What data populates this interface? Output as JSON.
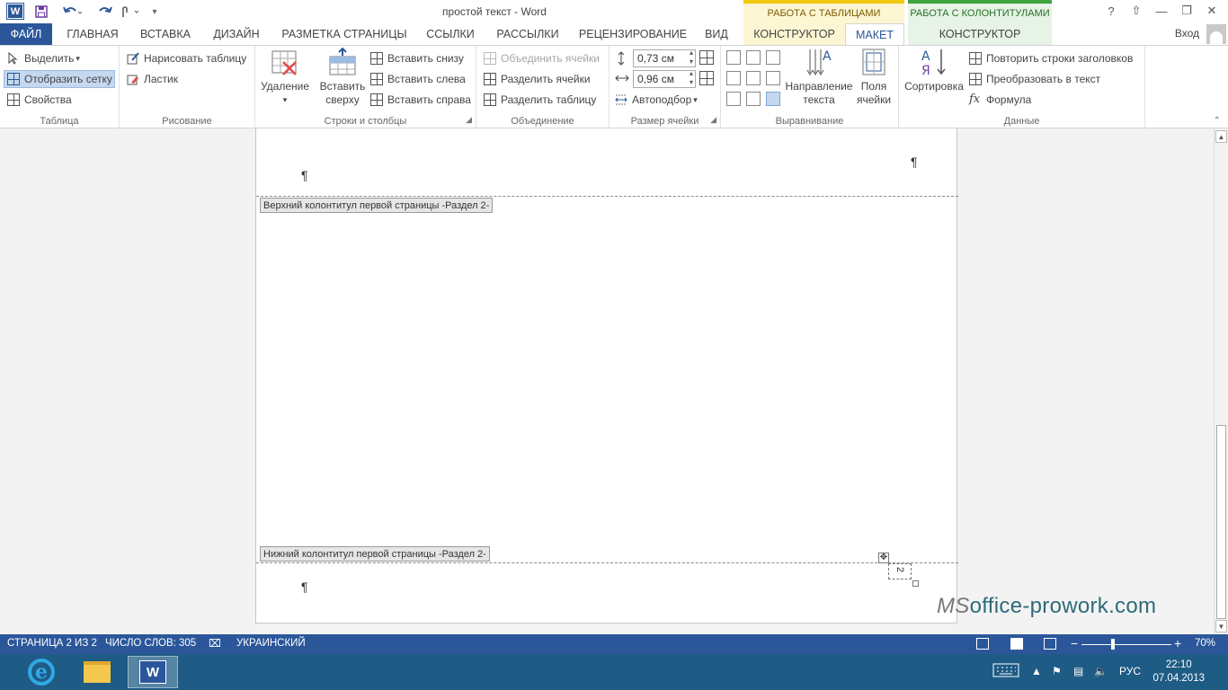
{
  "titlebar": {
    "app_badge": "W",
    "title": "простой текст - Word",
    "context_tables": "РАБОТА С ТАБЛИЦАМИ",
    "context_headers": "РАБОТА С КОЛОНТИТУЛАМИ",
    "help": "?",
    "ribbon_display": "⇧",
    "minimize": "—",
    "restore": "❐",
    "close": "✕"
  },
  "tabs": {
    "file": "ФАЙЛ",
    "home": "ГЛАВНАЯ",
    "insert": "ВСТАВКА",
    "design": "ДИЗАЙН",
    "page_layout": "РАЗМЕТКА СТРАНИЦЫ",
    "references": "ССЫЛКИ",
    "mailings": "РАССЫЛКИ",
    "review": "РЕЦЕНЗИРОВАНИЕ",
    "view": "ВИД",
    "table_design": "КОНСТРУКТОР",
    "table_layout": "МАКЕТ",
    "header_design": "КОНСТРУКТОР",
    "sign_in": "Вход"
  },
  "ribbon": {
    "table": {
      "label": "Таблица",
      "select": "Выделить",
      "view_gridlines": "Отобразить сетку",
      "properties": "Свойства"
    },
    "draw": {
      "label": "Рисование",
      "draw_table": "Нарисовать таблицу",
      "eraser": "Ластик"
    },
    "rows_cols": {
      "label": "Строки и столбцы",
      "delete": "Удаление",
      "insert_above_1": "Вставить",
      "insert_above_2": "сверху",
      "insert_below": "Вставить снизу",
      "insert_left": "Вставить слева",
      "insert_right": "Вставить справа"
    },
    "merge": {
      "label": "Объединение",
      "merge_cells": "Объединить ячейки",
      "split_cells": "Разделить ячейки",
      "split_table": "Разделить таблицу"
    },
    "cell_size": {
      "label": "Размер ячейки",
      "height": "0,73 см",
      "width": "0,96 см",
      "autofit": "Автоподбор"
    },
    "alignment": {
      "label": "Выравнивание",
      "text_direction_1": "Направление",
      "text_direction_2": "текста",
      "cell_margins_1": "Поля",
      "cell_margins_2": "ячейки"
    },
    "data": {
      "label": "Данные",
      "sort": "Сортировка",
      "repeat_headers": "Повторить строки заголовков",
      "convert_text": "Преобразовать в текст",
      "formula": "Формула"
    }
  },
  "document": {
    "pilcrow": "¶",
    "header_tag": "Верхний колонтитул первой страницы -Раздел 2-",
    "footer_tag": "Нижний колонтитул первой страницы -Раздел 2-",
    "page_number": "2"
  },
  "watermark": {
    "prefix": "MS",
    "rest": "office-prowork.com"
  },
  "statusbar": {
    "page": "СТРАНИЦА 2 ИЗ 2",
    "words": "ЧИСЛО СЛОВ: 305",
    "language": "УКРАИНСКИЙ",
    "zoom_minus": "−",
    "zoom_plus": "+",
    "zoom": "70%"
  },
  "taskbar": {
    "ie_letter": "e",
    "word_letter": "W",
    "lang": "РУС",
    "time": "22:10",
    "date": "07.04.2013"
  }
}
